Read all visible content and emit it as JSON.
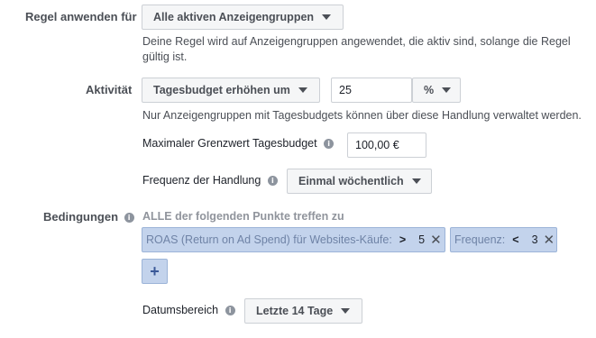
{
  "apply_rule": {
    "label": "Regel anwenden für",
    "dropdown": "Alle aktiven Anzeigengruppen",
    "help": "Deine Regel wird auf Anzeigengruppen angewendet, die aktiv sind, solange die Regel gültig ist."
  },
  "activity": {
    "label": "Aktivität",
    "action_dropdown": "Tagesbudget erhöhen um",
    "amount_value": "25",
    "unit_dropdown": "%",
    "help": "Nur Anzeigengruppen mit Tagesbudgets können über diese Handlung verwaltet werden.",
    "max_label": "Maximaler Grenzwert Tagesbudget",
    "max_value": "100,00 €",
    "frequency_label": "Frequenz der Handlung",
    "frequency_dropdown": "Einmal wöchentlich"
  },
  "conditions": {
    "label": "Bedingungen",
    "heading": "ALLE der folgenden Punkte treffen zu",
    "items": [
      {
        "label": "ROAS (Return on Ad Spend) für Websites-Käufe:",
        "operator": ">",
        "value": "5",
        "remove": "✕"
      },
      {
        "label": "Frequenz:",
        "operator": "<",
        "value": "3",
        "remove": "✕"
      }
    ],
    "add_button": "+"
  },
  "date_range": {
    "label": "Datumsbereich",
    "dropdown": "Letzte 14 Tage"
  },
  "icons": {
    "info": "i",
    "caret": "caret-down-icon",
    "remove": "close-icon"
  }
}
